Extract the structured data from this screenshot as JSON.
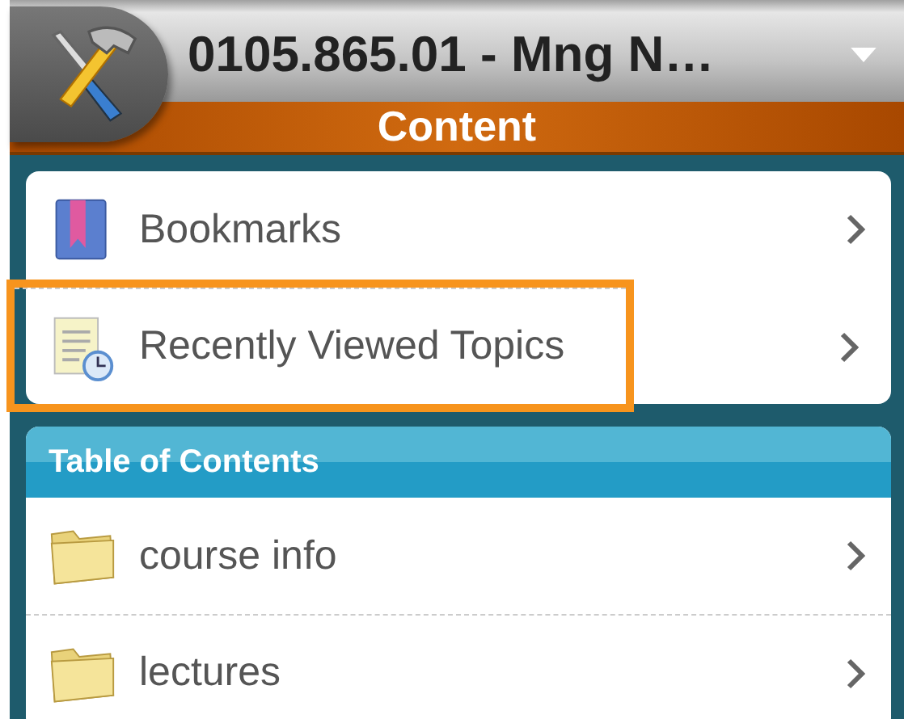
{
  "header": {
    "title": "0105.865.01 - Mng N…",
    "band_title": "Content"
  },
  "menu_items": [
    {
      "label": "Bookmarks",
      "kind": "bookmark",
      "highlighted": false
    },
    {
      "label": "Recently Viewed Topics",
      "kind": "history",
      "highlighted": true
    }
  ],
  "table_of_contents": {
    "title": "Table of Contents",
    "items": [
      {
        "label": "course info",
        "kind": "folder"
      },
      {
        "label": "lectures",
        "kind": "folder"
      }
    ]
  }
}
